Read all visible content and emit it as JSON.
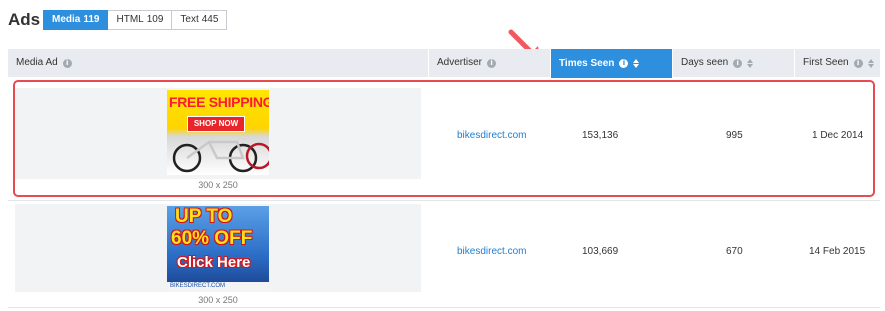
{
  "header": {
    "title": "Ads",
    "tabs": [
      {
        "label": "Media",
        "count": "119",
        "active": true
      },
      {
        "label": "HTML",
        "count": "109",
        "active": false
      },
      {
        "label": "Text",
        "count": "445",
        "active": false
      }
    ]
  },
  "table": {
    "columns": [
      {
        "label": "Media Ad",
        "info": true,
        "sortable": false
      },
      {
        "label": "Advertiser",
        "info": true,
        "sortable": false
      },
      {
        "label": "Times Seen",
        "info": true,
        "sortable": true,
        "sorted": true
      },
      {
        "label": "Days seen",
        "info": true,
        "sortable": true
      },
      {
        "label": "First Seen",
        "info": true,
        "sortable": true
      }
    ],
    "rows": [
      {
        "ad": {
          "line1": "FREE SHIPPING",
          "button": "SHOP NOW",
          "dimensions": "300 x 250"
        },
        "advertiser": "bikesdirect.com",
        "times_seen": "153,136",
        "days_seen": "995",
        "first_seen": "1 Dec 2014"
      },
      {
        "ad": {
          "line1": "UP TO",
          "line2": "60% OFF",
          "line3": "Click Here",
          "footer": "BIKESDIRECT.COM",
          "dimensions": "300 x 250"
        },
        "advertiser": "bikesdirect.com",
        "times_seen": "103,669",
        "days_seen": "670",
        "first_seen": "14 Feb 2015"
      }
    ]
  },
  "colors": {
    "accent": "#2d8fde",
    "highlight": "#e84b4f",
    "arrow": "#f05a5e",
    "link": "#1e7fd0"
  }
}
